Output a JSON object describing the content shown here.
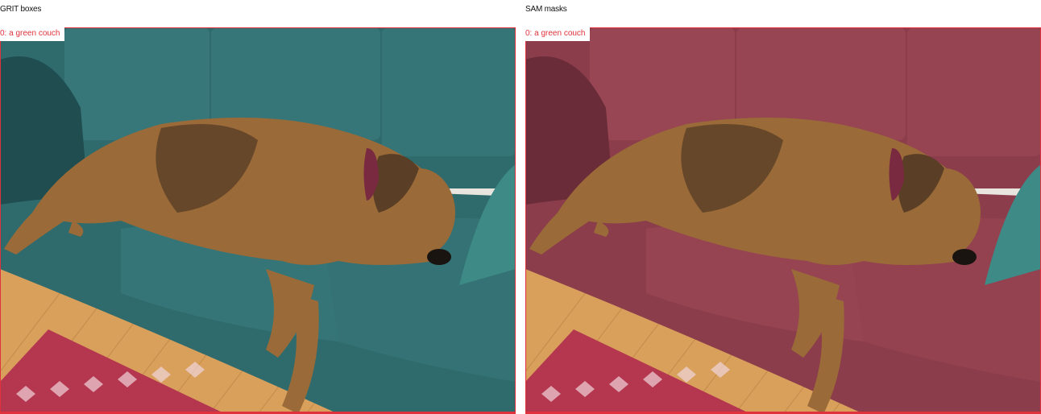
{
  "panels": [
    {
      "title": "GRIT boxes",
      "label": "0: a green couch",
      "couch_color": "#2f6b6d",
      "couch_shadow": "#1f4d50",
      "couch_light": "#3e8284"
    },
    {
      "title": "SAM masks",
      "label": "0: a green couch",
      "couch_color": "#8c3d4b",
      "couch_shadow": "#6b2c39",
      "couch_light": "#a24e5c"
    }
  ],
  "colors": {
    "box": "#e0323c",
    "floor": "#d9a05c",
    "floor_dark": "#b47c3c",
    "rug": "#b4374f",
    "dog": "#9a6a38",
    "dog_dark": "#4a3422",
    "collar": "#7a2a40",
    "wall": "#e8e4de"
  }
}
